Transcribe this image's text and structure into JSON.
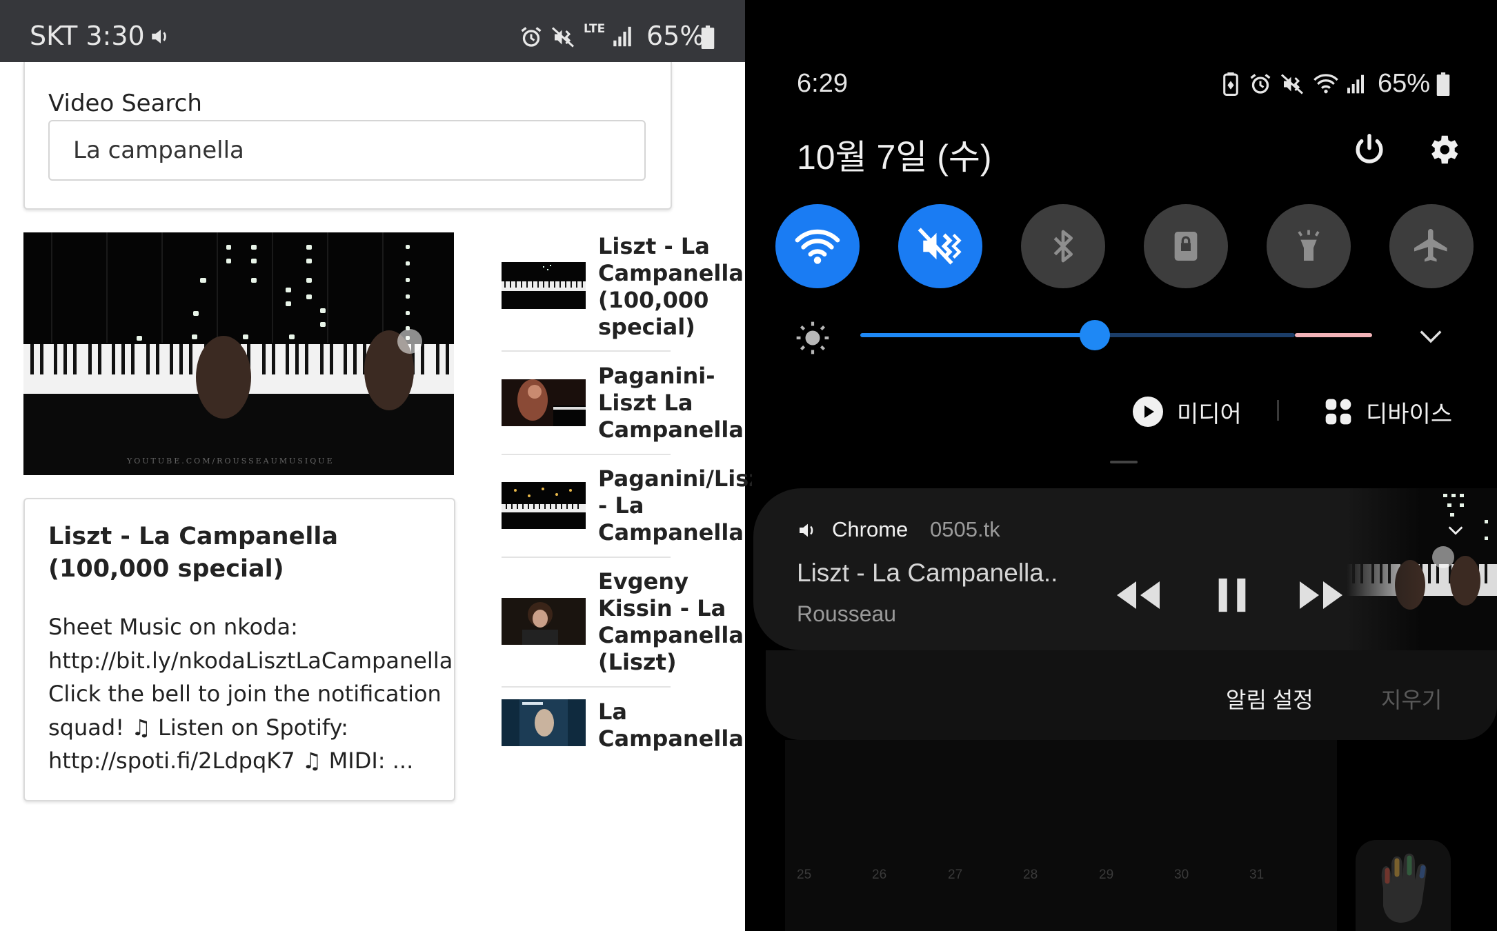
{
  "left_status": {
    "carrier_time": "SKT 3:30",
    "network": "LTE",
    "battery": "65%"
  },
  "search": {
    "label": "Video Search",
    "value": "La campanella"
  },
  "main_video": {
    "watermark": "YOUTUBE.COM/ROUSSEAUMUSIQUE",
    "title": "Liszt - La Campanella (100,000 special)",
    "description": "Sheet Music on nkoda: http://bit.ly/nkodaLisztLaCampanella Click the bell to join the notification squad! ♫ Listen on Spotify: http://spoti.fi/2LdpqK7 ♫ MIDI: ..."
  },
  "related": [
    {
      "title": "Liszt - La Campanella (100,000 special)"
    },
    {
      "title": "Paganini-Liszt La Campanella"
    },
    {
      "title": "Paganini/Liszt - La Campanella"
    },
    {
      "title": "Evgeny Kissin - La Campanella (Liszt)"
    },
    {
      "title": "La Campanella"
    }
  ],
  "right_status": {
    "time": "6:29",
    "battery": "65%"
  },
  "panel": {
    "date": "10월 7일 (수)",
    "media_label": "미디어",
    "devices_label": "디바이스"
  },
  "quick_settings": [
    {
      "name": "wifi",
      "state": "on"
    },
    {
      "name": "sound-vibrate",
      "state": "on"
    },
    {
      "name": "bluetooth",
      "state": "off"
    },
    {
      "name": "screen-lock",
      "state": "off"
    },
    {
      "name": "flashlight",
      "state": "off"
    },
    {
      "name": "airplane-mode",
      "state": "off"
    }
  ],
  "brightness": {
    "level": 0.46
  },
  "media_player": {
    "app": "Chrome",
    "source": "0505.tk",
    "title": "Liszt - La Campanella..",
    "artist": "Rousseau"
  },
  "notification_actions": {
    "settings": "알림 설정",
    "clear": "지우기"
  },
  "calendar_numbers": [
    "25",
    "26",
    "27",
    "28",
    "29",
    "30",
    "31"
  ],
  "colors": {
    "accent_blue": "#1a7cf3",
    "left_statusbar": "#36373b",
    "tile_off": "#3d3d3d"
  }
}
